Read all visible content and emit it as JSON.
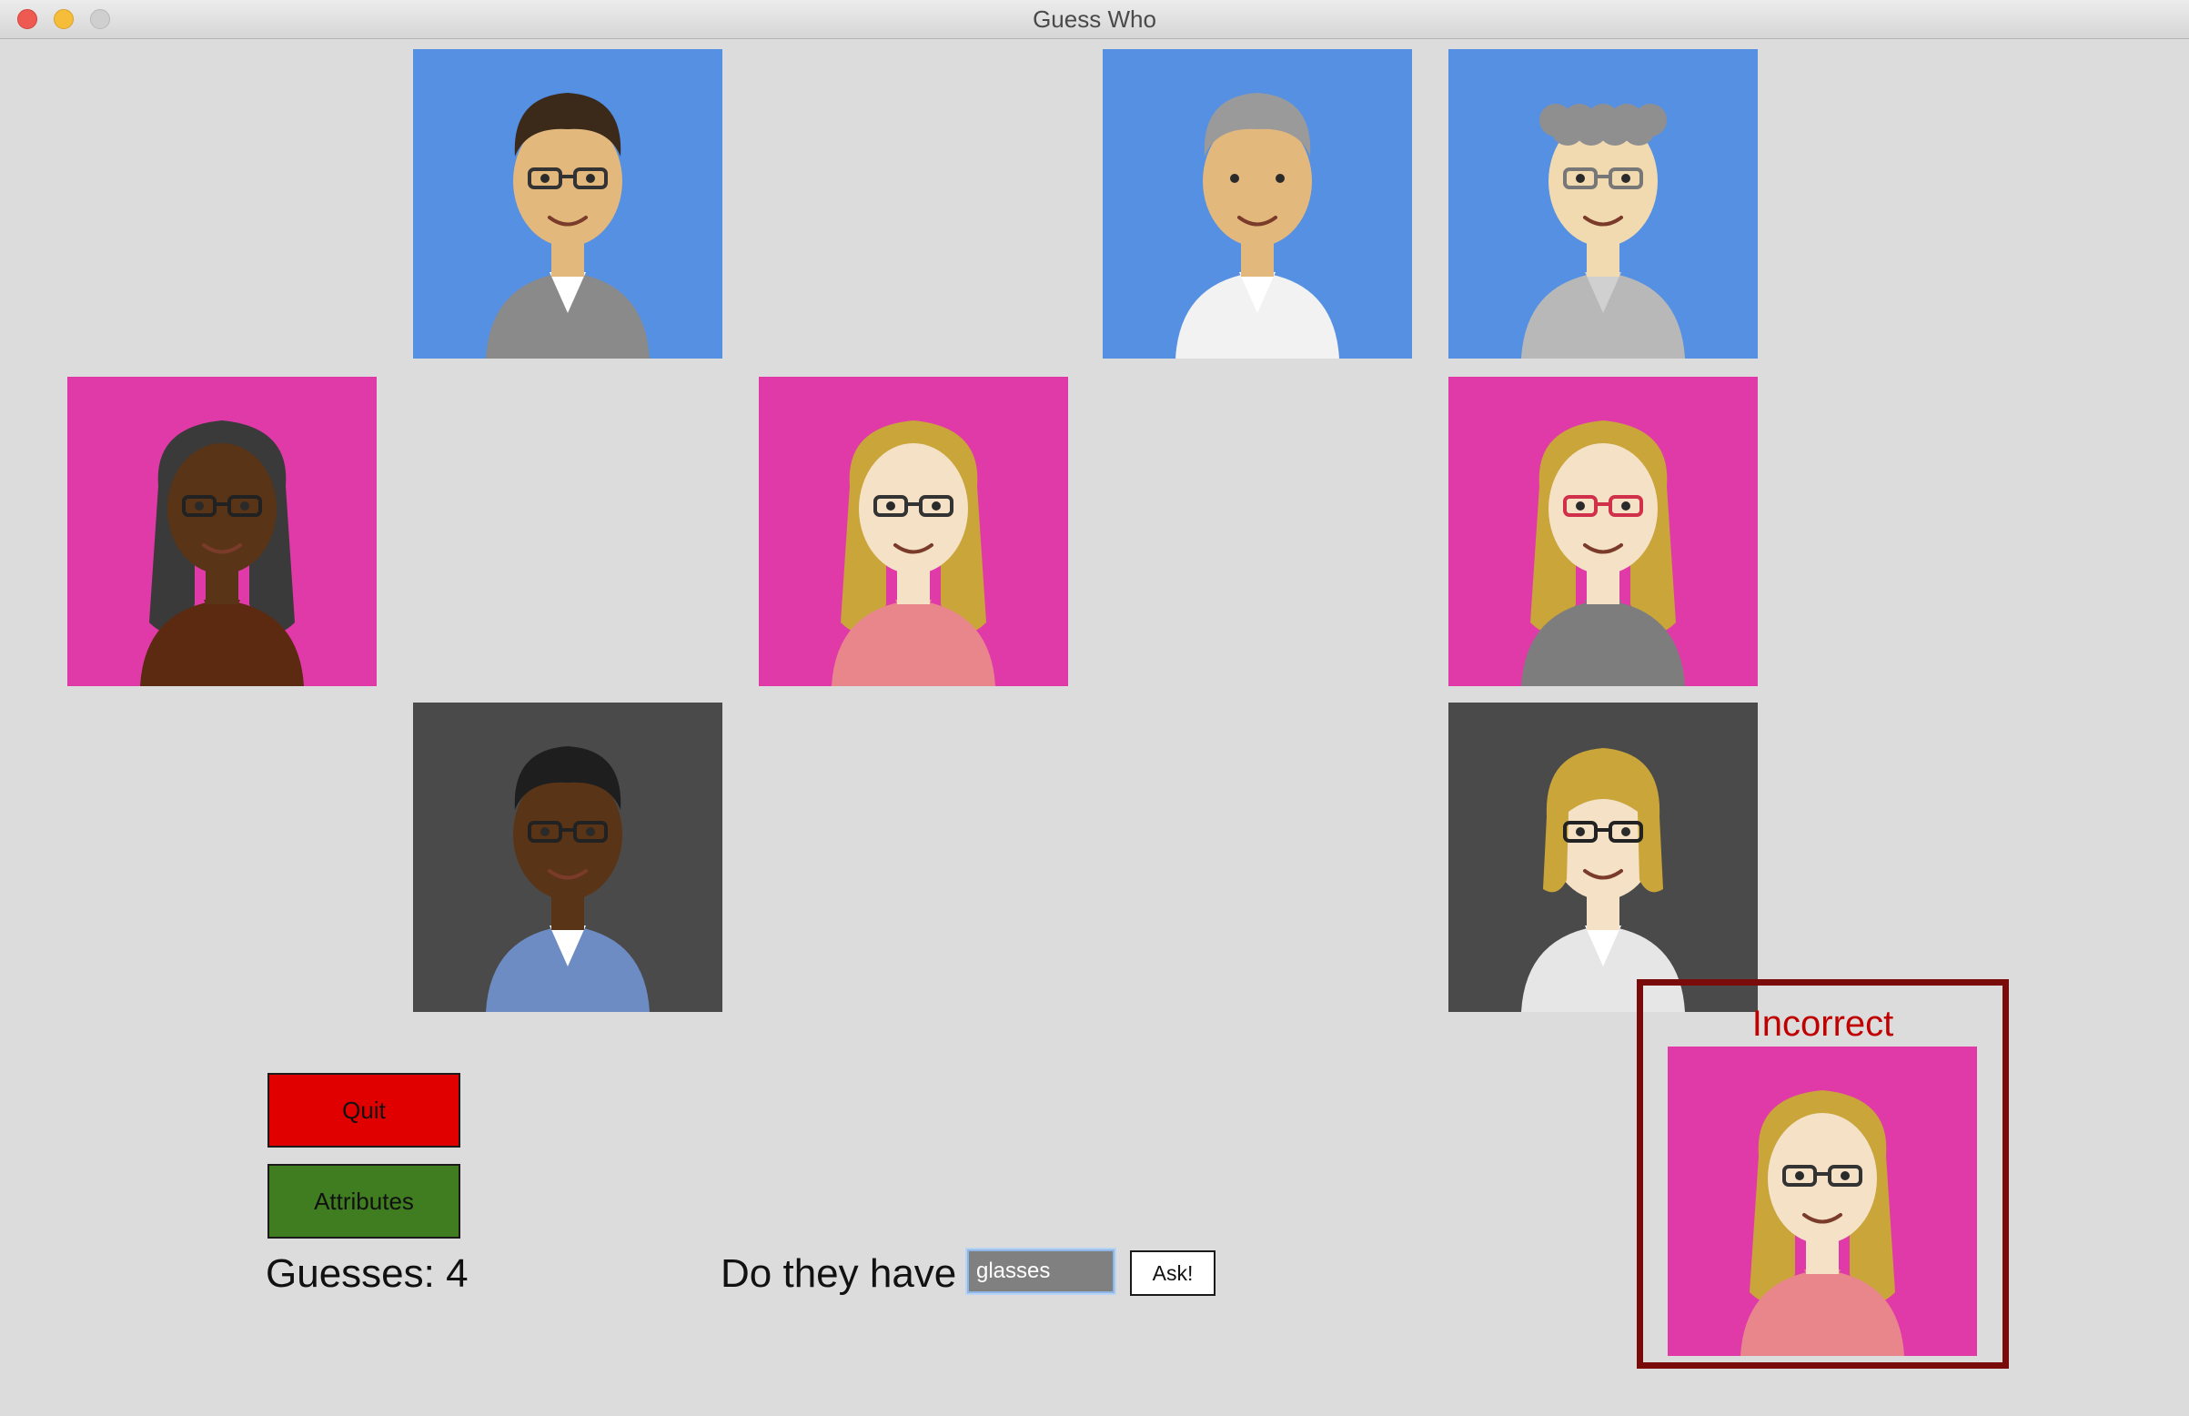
{
  "window": {
    "title": "Guess Who"
  },
  "colors": {
    "background_blue": "#5590e3",
    "background_pink": "#e03aa8",
    "background_dark": "#4a4a4a",
    "quit_button": "#e00000",
    "attributes_button": "#3f7d20",
    "result_text": "#c00000",
    "result_border": "#7a0b0b"
  },
  "board": {
    "characters": [
      {
        "icon": "man-dark-hair-glasses-cardigan-avatar",
        "background": "blue"
      },
      {
        "icon": "man-gray-hair-white-shirt-avatar",
        "background": "blue"
      },
      {
        "icon": "man-curly-gray-hair-glasses-avatar",
        "background": "blue"
      },
      {
        "icon": "woman-dark-curly-hair-glasses-avatar",
        "background": "pink"
      },
      {
        "icon": "woman-blonde-hair-glasses-avatar",
        "background": "pink"
      },
      {
        "icon": "woman-blonde-curly-hair-red-glasses-avatar",
        "background": "pink"
      },
      {
        "icon": "man-black-hair-glasses-plaid-shirt-avatar",
        "background": "dark"
      },
      {
        "icon": "woman-blonde-hair-glasses-white-top-avatar",
        "background": "dark"
      }
    ]
  },
  "controls": {
    "quit_label": "Quit",
    "attributes_label": "Attributes",
    "guesses_text": "Guesses: 4",
    "question_label": "Do they have",
    "question_value": "glasses",
    "ask_label": "Ask!"
  },
  "result": {
    "text": "Incorrect",
    "icon": "woman-blonde-hair-glasses-avatar",
    "background": "pink"
  }
}
